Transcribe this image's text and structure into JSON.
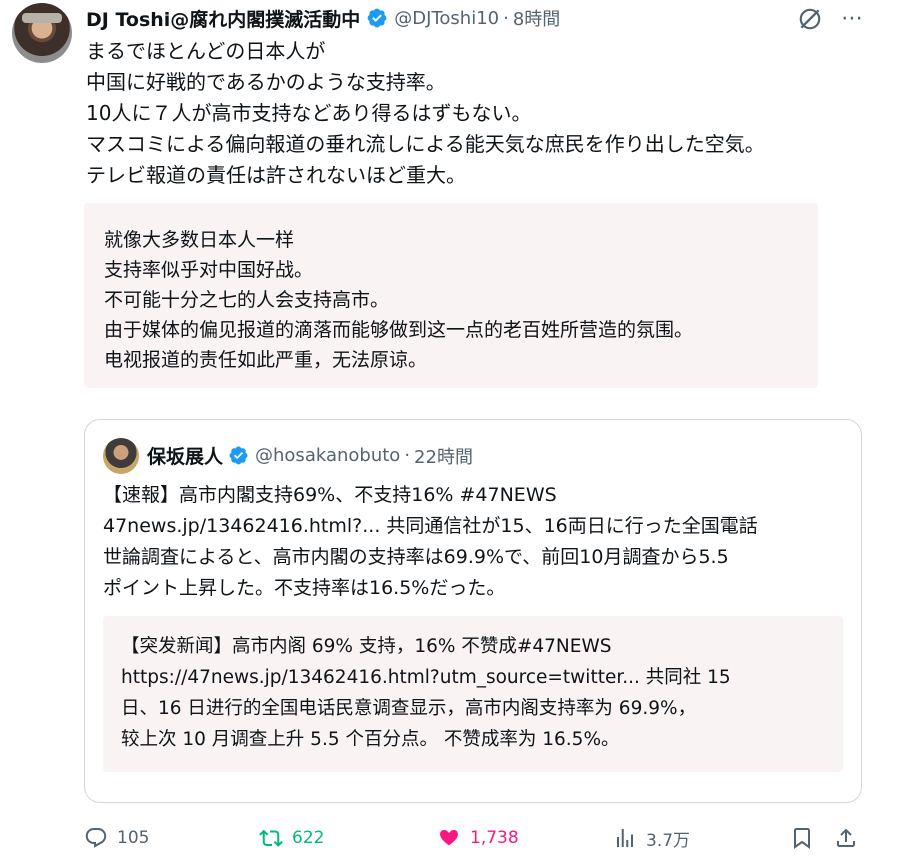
{
  "tweet": {
    "author_name": "DJ Toshi@腐れ内閣撲滅活動中",
    "handle": "@DJToshi10",
    "separator": "·",
    "time": "8時間",
    "text": "まるでほとんどの日本人が\n中国に好戦的であるかのような支持率。\n10人に７人が高市支持などあり得るはずもない。\nマスコミによる偏向報道の垂れ流しによる能天気な庶民を作り出した空気。\nテレビ報道の責任は許されないほど重大。",
    "translation": "就像大多数日本人一样\n支持率似乎对中国好战。\n不可能十分之七的人会支持高市。\n由于媒体的偏见报道的滴落而能够做到这一点的老百姓所营造的氛围。\n电视报道的责任如此严重，无法原谅。",
    "more_icon": "⋯"
  },
  "quote": {
    "author_name": "保坂展人",
    "handle": "@hosakanobuto",
    "separator": "·",
    "time": "22時間",
    "text": "【速報】高市内閣支持69%、不支持16% #47NEWS\n47news.jp/13462416.html?... 共同通信社が15、16両日に行った全国電話\n世論調査によると、高市内閣の支持率は69.9%で、前回10月調査から5.5\nポイント上昇した。不支持率は16.5%だった。",
    "translation": "【突发新闻】高市内阁 69% 支持，16% 不赞成#47NEWS\nhttps://47news.jp/13462416.html?utm_source=twitter... 共同社 15\n日、16 日进行的全国电话民意调查显示，高市内阁支持率为 69.9%，\n较上次 10 月调查上升 5.5 个百分点。 不赞成率为 16.5%。"
  },
  "actions": {
    "replies": "105",
    "retweets": "622",
    "likes": "1,738",
    "views": "3.7万"
  },
  "colors": {
    "verified": "#1d9bf0",
    "retweet": "#00ba7c",
    "like": "#f91880",
    "muted": "#536471"
  }
}
